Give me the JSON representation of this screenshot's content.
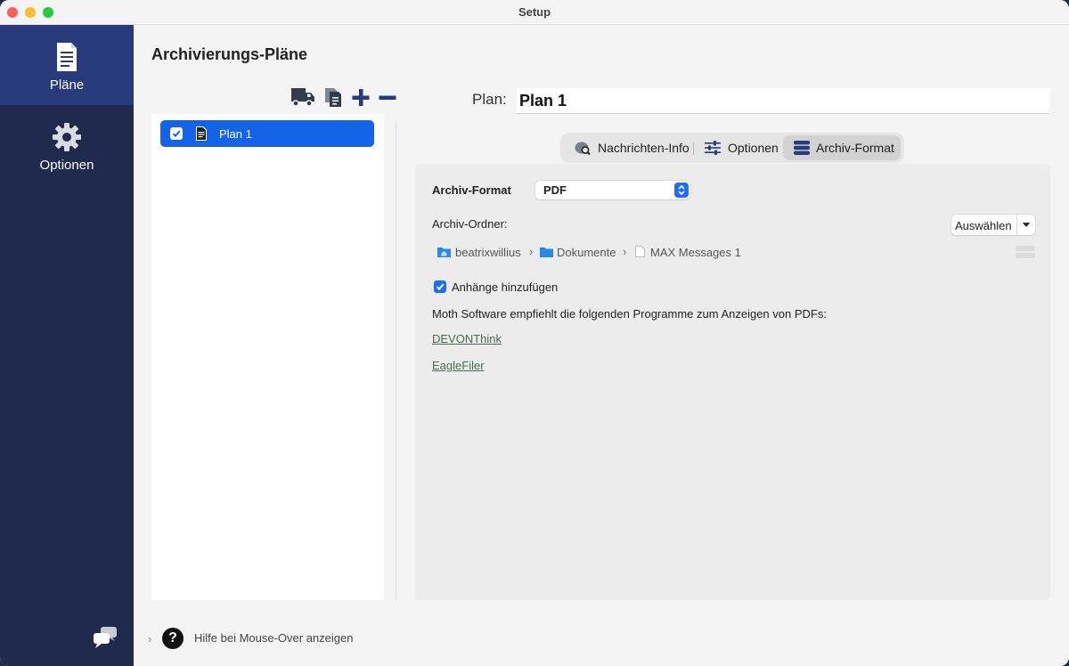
{
  "window": {
    "title": "Setup"
  },
  "sidebar": {
    "items": [
      {
        "label": "Pläne",
        "icon": "document-icon"
      },
      {
        "label": "Optionen",
        "icon": "gear-icon"
      }
    ],
    "bottom_icon": "chat-bubbles-icon"
  },
  "page": {
    "title": "Archivierungs-Pläne"
  },
  "toolbar": {
    "icons": [
      "truck-icon",
      "duplicate-icon",
      "plus-icon",
      "minus-icon"
    ]
  },
  "plans": [
    {
      "label": "Plan 1",
      "checked": true,
      "selected": true
    }
  ],
  "plan_field": {
    "label": "Plan:",
    "value": "Plan 1"
  },
  "tabs": [
    {
      "label": "Nachrichten-Info",
      "icon": "message-search-icon"
    },
    {
      "label": "Optionen",
      "icon": "sliders-icon"
    },
    {
      "label": "Archiv-Format",
      "icon": "database-icon",
      "selected": true
    }
  ],
  "archive": {
    "format_label": "Archiv-Format",
    "format_value": "PDF",
    "folder_label": "Archiv-Ordner:",
    "choose_button": "Auswählen",
    "path": [
      {
        "label": "beatrixwillius",
        "icon": "home-folder-icon"
      },
      {
        "label": "Dokumente",
        "icon": "folder-icon"
      },
      {
        "label": "MAX Messages 1",
        "icon": "file-icon"
      }
    ],
    "path_separator": "›",
    "attachments_label": "Anhänge hinzufügen",
    "attachments_checked": true,
    "recommend_text": "Moth Software empfiehlt die folgenden Programme zum Anzeigen von PDFs:",
    "links": [
      "DEVONThink",
      "EagleFiler"
    ]
  },
  "help": {
    "label": "Hilfe bei Mouse-Over anzeigen",
    "icon_glyph": "?"
  },
  "colors": {
    "sidebar": "#1f2a4d",
    "sidebar_active": "#283a7a",
    "accent": "#1463e6"
  }
}
